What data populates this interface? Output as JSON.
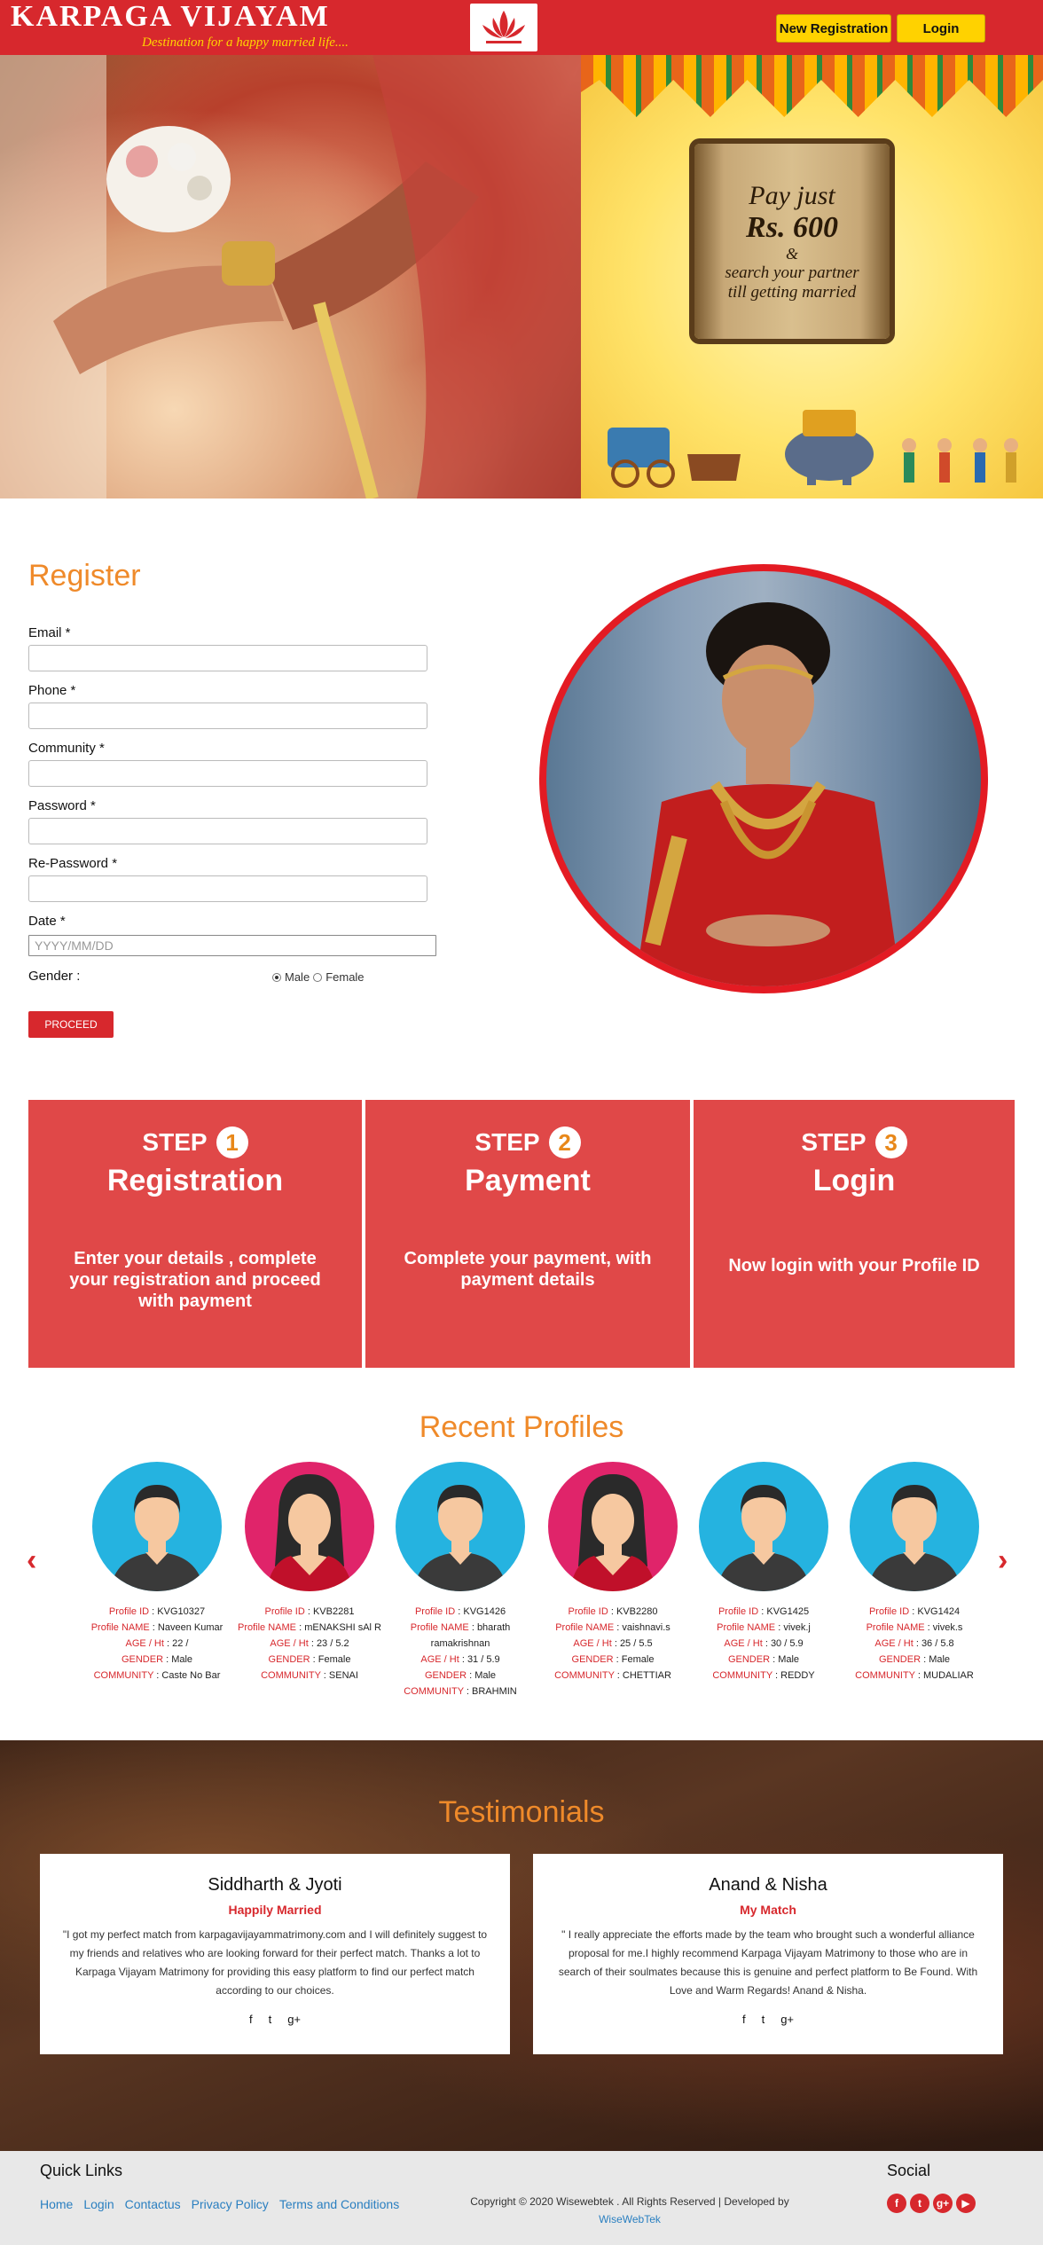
{
  "header": {
    "brand": "KARPAGA VIJAYAM",
    "tagline": "Destination for a happy married life....",
    "new_registration": "New Registration",
    "login": "Login",
    "logo_icon": "lotus-icon"
  },
  "hero": {
    "offer_line1": "Pay just",
    "offer_price": "Rs. 600",
    "offer_amp": "&",
    "offer_line2": "search your partner",
    "offer_line3": "till getting married"
  },
  "register": {
    "title": "Register",
    "email_label": "Email *",
    "phone_label": "Phone *",
    "community_label": "Community *",
    "password_label": "Password *",
    "repassword_label": "Re-Password *",
    "date_label": "Date *",
    "date_placeholder": "YYYY/MM/DD",
    "gender_label": "Gender :",
    "gender_options": [
      "Male",
      "Female"
    ],
    "gender_selected": "Male",
    "proceed": "PROCEED"
  },
  "steps": [
    {
      "word": "STEP",
      "num": "1",
      "title": "Registration",
      "desc": "Enter your details , complete your registration and proceed with payment"
    },
    {
      "word": "STEP",
      "num": "2",
      "title": "Payment",
      "desc": "Complete your payment, with payment details"
    },
    {
      "word": "STEP",
      "num": "3",
      "title": "Login",
      "desc": "Now login with your Profile ID"
    }
  ],
  "recent_profiles": {
    "title": "Recent Profiles",
    "keys": {
      "id": "Profile ID",
      "name": "Profile NAME",
      "age": "AGE / Ht",
      "gender": "GENDER",
      "community": "COMMUNITY"
    },
    "items": [
      {
        "gender_icon": "male-avatar-icon",
        "id": "KVG10327",
        "name": "Naveen Kumar",
        "age": "22 /",
        "gender": "Male",
        "community": "Caste No Bar"
      },
      {
        "gender_icon": "female-avatar-icon",
        "id": "KVB2281",
        "name": "mENAKSHI sAl R",
        "age": "23 / 5.2",
        "gender": "Female",
        "community": "SENAI"
      },
      {
        "gender_icon": "male-avatar-icon",
        "id": "KVG1426",
        "name": "bharath ramakrishnan",
        "age": "31 / 5.9",
        "gender": "Male",
        "community": "BRAHMIN"
      },
      {
        "gender_icon": "female-avatar-icon",
        "id": "KVB2280",
        "name": "vaishnavi.s",
        "age": "25 / 5.5",
        "gender": "Female",
        "community": "CHETTIAR"
      },
      {
        "gender_icon": "male-avatar-icon",
        "id": "KVG1425",
        "name": "vivek.j",
        "age": "30 / 5.9",
        "gender": "Male",
        "community": "REDDY"
      },
      {
        "gender_icon": "male-avatar-icon",
        "id": "KVG1424",
        "name": "vivek.s",
        "age": "36 / 5.8",
        "gender": "Male",
        "community": "MUDALIAR"
      }
    ]
  },
  "testimonials": {
    "title": "Testimonials",
    "items": [
      {
        "name": "Siddharth & Jyoti",
        "status": "Happily Married",
        "quote": "\"I got my perfect match from karpagavijayammatrimony.com and I will definitely suggest to my friends and relatives who are looking forward for their perfect match. Thanks a lot to Karpaga Vijayam Matrimony for providing this easy platform to find our perfect match according to our choices."
      },
      {
        "name": "Anand & Nisha",
        "status": "My Match",
        "quote": "\" I really appreciate the efforts made by the team who brought such a wonderful alliance proposal for me.I highly recommend Karpaga Vijayam Matrimony to those who are in search of their soulmates because this is genuine and perfect platform to Be Found. With Love and Warm Regards! Anand & Nisha."
      }
    ],
    "social_glyphs": [
      "f",
      "t",
      "g+"
    ]
  },
  "footer": {
    "quick_links_title": "Quick Links",
    "links": [
      "Home",
      "Login",
      "Contactus",
      "Privacy Policy",
      "Terms and Conditions"
    ],
    "copyright": "Copyright © 2020 Wisewebtek . All Rights Reserved | Developed by",
    "developer": "WiseWebTek",
    "social_title": "Social",
    "social_glyphs": [
      "f",
      "t",
      "g+",
      "▶"
    ]
  },
  "colors": {
    "primary_red": "#d7282d",
    "accent_orange": "#ef8a2a",
    "header_yellow": "#ffd200",
    "step_red": "#e04848"
  }
}
